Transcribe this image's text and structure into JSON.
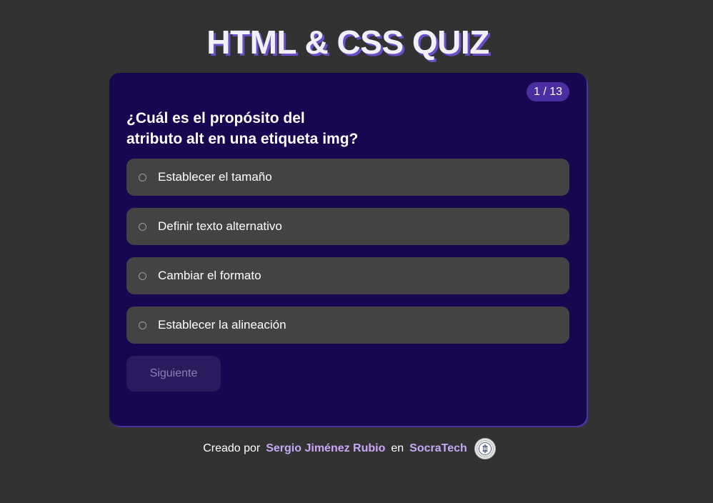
{
  "header": {
    "title": "HTML & CSS QUIZ"
  },
  "quiz": {
    "counter": "1 / 13",
    "question_line1": "¿Cuál es el propósito del",
    "question_line2": "atributo alt en una etiqueta img?",
    "options": [
      {
        "label": "Establecer el tamaño"
      },
      {
        "label": "Definir texto alternativo"
      },
      {
        "label": "Cambiar el formato"
      },
      {
        "label": "Establecer la alineación"
      }
    ],
    "next_label": "Siguiente"
  },
  "footer": {
    "created_by": "Creado por",
    "author": "Sergio Jiménez Rubio",
    "at": "en",
    "org": "SocraTech",
    "seal_icon": "socratech-seal-icon"
  },
  "colors": {
    "background": "#323232",
    "card": "#170650",
    "option": "#434343",
    "accent": "#4a2ea0",
    "link": "#c7a8f5"
  }
}
